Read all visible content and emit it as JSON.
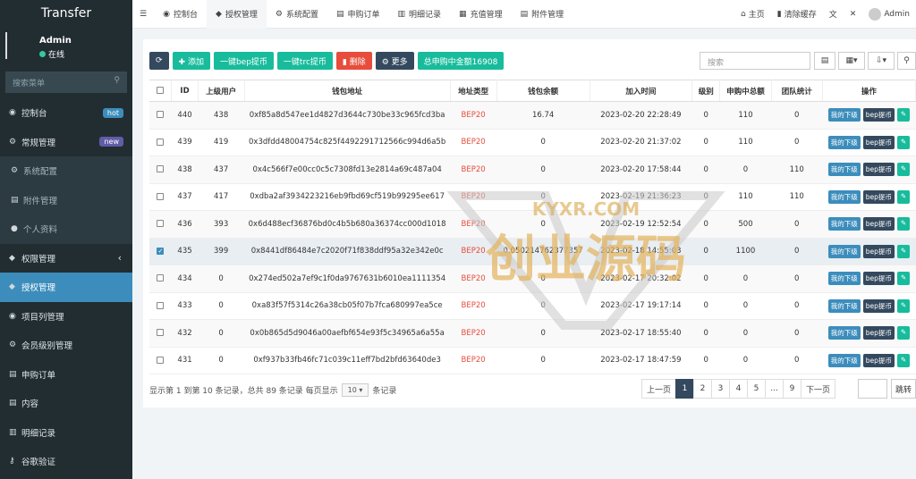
{
  "sidebar": {
    "brand": "Transfer",
    "user": {
      "name": "Admin",
      "status": "在线"
    },
    "search_placeholder": "搜索菜单",
    "items": [
      {
        "icon": "dashboard-icon",
        "glyph": "◉",
        "label": "控制台",
        "badge": "hot"
      },
      {
        "icon": "cogs-icon",
        "glyph": "⚙",
        "label": "常规管理",
        "badge": "new"
      },
      {
        "icon": "gear-icon",
        "glyph": "⚙",
        "label": "系统配置",
        "sub": true
      },
      {
        "icon": "file-icon",
        "glyph": "▤",
        "label": "附件管理",
        "sub": true
      },
      {
        "icon": "user-icon",
        "glyph": "●",
        "label": "个人资料",
        "sub": true
      },
      {
        "icon": "group-icon",
        "glyph": "◆",
        "label": "权限管理",
        "chevron": "‹"
      },
      {
        "icon": "group-icon",
        "glyph": "◆",
        "label": "授权管理",
        "active": true
      },
      {
        "icon": "circle-play-icon",
        "glyph": "◉",
        "label": "项目列管理"
      },
      {
        "icon": "cog-icon",
        "glyph": "⚙",
        "label": "会员级别管理"
      },
      {
        "icon": "list-icon",
        "glyph": "▤",
        "label": "申购订单"
      },
      {
        "icon": "list-icon",
        "glyph": "▤",
        "label": "内容"
      },
      {
        "icon": "chart-icon",
        "glyph": "▥",
        "label": "明细记录"
      },
      {
        "icon": "key-icon",
        "glyph": "⚷",
        "label": "谷歌验证"
      }
    ]
  },
  "topbar": {
    "tabs": [
      {
        "icon": "dashboard-icon",
        "glyph": "◉",
        "label": "控制台"
      },
      {
        "icon": "group-icon",
        "glyph": "◆",
        "label": "授权管理",
        "active": true
      },
      {
        "icon": "gear-icon",
        "glyph": "⚙",
        "label": "系统配置"
      },
      {
        "icon": "list-icon",
        "glyph": "▤",
        "label": "申购订单"
      },
      {
        "icon": "chart-icon",
        "glyph": "▥",
        "label": "明细记录"
      },
      {
        "icon": "calendar-icon",
        "glyph": "▦",
        "label": "充值管理"
      },
      {
        "icon": "file-icon",
        "glyph": "▤",
        "label": "附件管理"
      }
    ],
    "right": [
      {
        "icon": "home-icon",
        "glyph": "⌂",
        "label": "主页"
      },
      {
        "icon": "trash-icon",
        "glyph": "▮",
        "label": "清除缓存"
      },
      {
        "icon": "translate-icon",
        "glyph": "文",
        "label": ""
      },
      {
        "icon": "fullscreen-icon",
        "glyph": "✕",
        "label": ""
      }
    ],
    "admin_name": "Admin"
  },
  "toolbar": {
    "buttons": [
      {
        "name": "refresh-button",
        "label": "⟳",
        "cls": "b-dark"
      },
      {
        "name": "add-button",
        "label": "✚ 添加",
        "cls": "b-green"
      },
      {
        "name": "bep-withdraw-button",
        "label": "一键bep提币",
        "cls": "b-green"
      },
      {
        "name": "trc-withdraw-button",
        "label": "一键trc提币",
        "cls": "b-green"
      },
      {
        "name": "delete-button",
        "label": "▮ 删除",
        "cls": "b-red"
      },
      {
        "name": "more-button",
        "label": "⚙ 更多",
        "cls": "b-dark"
      },
      {
        "name": "total-purchase-button",
        "label": "总申购中金额16908",
        "cls": "b-green"
      }
    ],
    "search_placeholder": "搜索"
  },
  "table": {
    "headers": [
      "ID",
      "上级用户",
      "钱包地址",
      "地址类型",
      "钱包余额",
      "加入时间",
      "级别",
      "申购中总额",
      "团队统计",
      "操作"
    ],
    "rows": [
      {
        "id": "440",
        "parent": "438",
        "addr": "0xf85a8d547ee1d4827d3644c730be33c965fcd3ba",
        "type": "BEP20",
        "balance": "16.74",
        "time": "2023-02-20 22:28:49",
        "level": "0",
        "total": "110",
        "team": "0",
        "checked": false
      },
      {
        "id": "439",
        "parent": "419",
        "addr": "0x3dfdd48004754c825f4492291712566c994d6a5b",
        "type": "BEP20",
        "balance": "0",
        "time": "2023-02-20 21:37:02",
        "level": "0",
        "total": "110",
        "team": "0",
        "checked": false
      },
      {
        "id": "438",
        "parent": "437",
        "addr": "0x4c566f7e00cc0c5c7308fd13e2814a69c487a04",
        "type": "BEP20",
        "balance": "0",
        "time": "2023-02-20 17:58:44",
        "level": "0",
        "total": "0",
        "team": "110",
        "checked": false
      },
      {
        "id": "437",
        "parent": "417",
        "addr": "0xdba2af3934223216eb9fbd69cf519b99295ee617",
        "type": "BEP20",
        "balance": "0",
        "time": "2023-02-19 21:36:23",
        "level": "0",
        "total": "110",
        "team": "110",
        "checked": false
      },
      {
        "id": "436",
        "parent": "393",
        "addr": "0x6d488ecf36876bd0c4b5b680a36374cc000d1018",
        "type": "BEP20",
        "balance": "0",
        "time": "2023-02-19 12:52:54",
        "level": "0",
        "total": "500",
        "team": "0",
        "checked": false
      },
      {
        "id": "435",
        "parent": "399",
        "addr": "0x8441df86484e7c2020f71f838ddf95a32e342e0c",
        "type": "BEP20",
        "balance": "0.050214762377357",
        "time": "2023-02-18 14:55:03",
        "level": "0",
        "total": "1100",
        "team": "0",
        "checked": true
      },
      {
        "id": "434",
        "parent": "0",
        "addr": "0x274ed502a7ef9c1f0da9767631b6010ea1111354",
        "type": "BEP20",
        "balance": "0",
        "time": "2023-02-17 20:32:02",
        "level": "0",
        "total": "0",
        "team": "0",
        "checked": false
      },
      {
        "id": "433",
        "parent": "0",
        "addr": "0xa83f57f5314c26a38cb05f07b7fca680997ea5ce",
        "type": "BEP20",
        "balance": "0",
        "time": "2023-02-17 19:17:14",
        "level": "0",
        "total": "0",
        "team": "0",
        "checked": false
      },
      {
        "id": "432",
        "parent": "0",
        "addr": "0x0b865d5d9046a00aefbf654e93f5c34965a6a55a",
        "type": "BEP20",
        "balance": "0",
        "time": "2023-02-17 18:55:40",
        "level": "0",
        "total": "0",
        "team": "0",
        "checked": false
      },
      {
        "id": "431",
        "parent": "0",
        "addr": "0xf937b33fb46fc71c039c11eff7bd2bfd63640de3",
        "type": "BEP20",
        "balance": "0",
        "time": "2023-02-17 18:47:59",
        "level": "0",
        "total": "0",
        "team": "0",
        "checked": false
      }
    ],
    "actions": [
      "我的下级",
      "bep提币"
    ]
  },
  "pagination": {
    "info_prefix": "显示第 1 到第 10 条记录，总共 89 条记录 每页显示",
    "page_size": "10 ▾",
    "info_suffix": "条记录",
    "pages": [
      "上一页",
      "1",
      "2",
      "3",
      "4",
      "5",
      "...",
      "9",
      "下一页"
    ],
    "current": "1",
    "jump_label": "跳转"
  },
  "watermark": {
    "top_text": "KYXR.COM",
    "main_text": "创业源码"
  }
}
